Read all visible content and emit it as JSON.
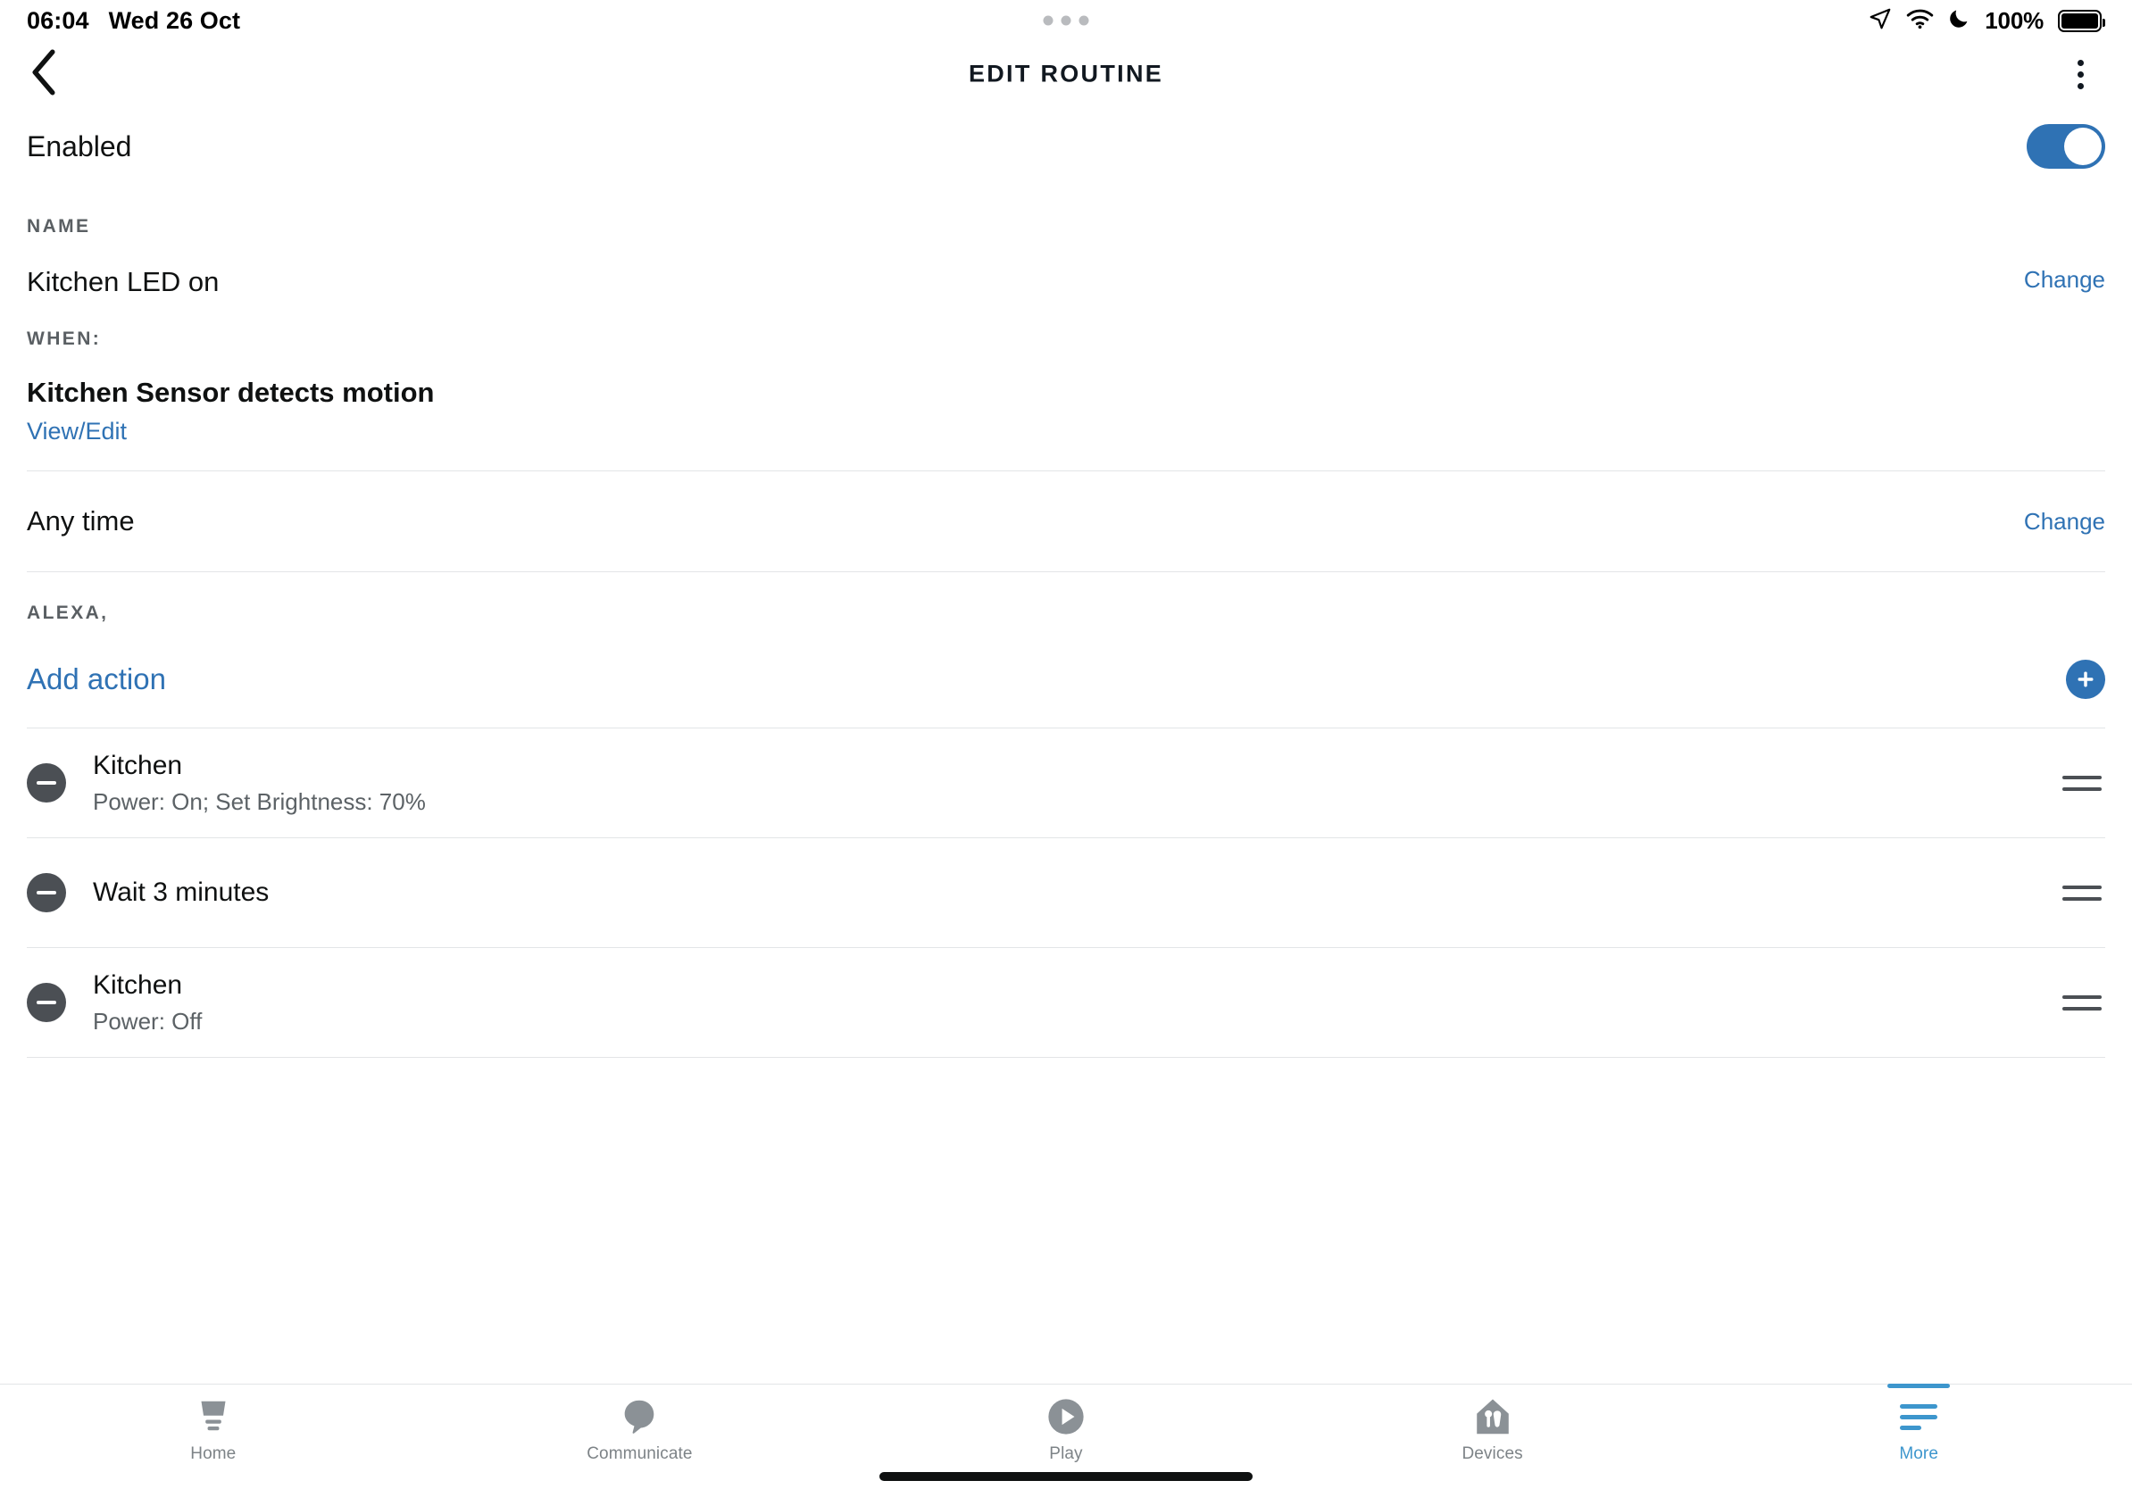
{
  "status_bar": {
    "time": "06:04",
    "date": "Wed 26 Oct",
    "battery_percent": "100%",
    "icons": [
      "location-arrow-icon",
      "wifi-icon",
      "moon-icon",
      "battery-icon"
    ]
  },
  "header": {
    "title": "EDIT ROUTINE",
    "back_icon": "chevron-left-icon",
    "overflow_icon": "kebab-menu-icon"
  },
  "enabled_row": {
    "label": "Enabled",
    "toggle_state": "on"
  },
  "name_section": {
    "label": "NAME",
    "value": "Kitchen LED on",
    "change_label": "Change"
  },
  "when_section": {
    "label": "WHEN:",
    "trigger": "Kitchen Sensor detects motion",
    "view_edit_label": "View/Edit",
    "time_value": "Any time",
    "time_change_label": "Change"
  },
  "alexa_section": {
    "label": "ALEXA,",
    "add_action_label": "Add action",
    "add_icon": "plus-circle-icon"
  },
  "actions": [
    {
      "title": "Kitchen",
      "subtitle": "Power: On; Set Brightness: 70%",
      "remove_icon": "minus-circle-icon",
      "drag_icon": "drag-handle-icon"
    },
    {
      "title": "Wait 3 minutes",
      "subtitle": "",
      "remove_icon": "minus-circle-icon",
      "drag_icon": "drag-handle-icon"
    },
    {
      "title": "Kitchen",
      "subtitle": "Power: Off",
      "remove_icon": "minus-circle-icon",
      "drag_icon": "drag-handle-icon"
    }
  ],
  "tabbar": {
    "items": [
      {
        "label": "Home",
        "icon": "home-icon",
        "active": false
      },
      {
        "label": "Communicate",
        "icon": "speech-bubble-icon",
        "active": false
      },
      {
        "label": "Play",
        "icon": "play-circle-icon",
        "active": false
      },
      {
        "label": "Devices",
        "icon": "devices-house-icon",
        "active": false
      },
      {
        "label": "More",
        "icon": "hamburger-menu-icon",
        "active": true
      }
    ]
  },
  "colors": {
    "accent_blue": "#2f72b4",
    "tab_active_blue": "#3d96cd",
    "text_primary": "#0f1111",
    "text_secondary": "#5c6266",
    "divider": "#e3e5e7",
    "icon_gray": "#4b4f54",
    "tab_inactive": "#8b9196"
  }
}
